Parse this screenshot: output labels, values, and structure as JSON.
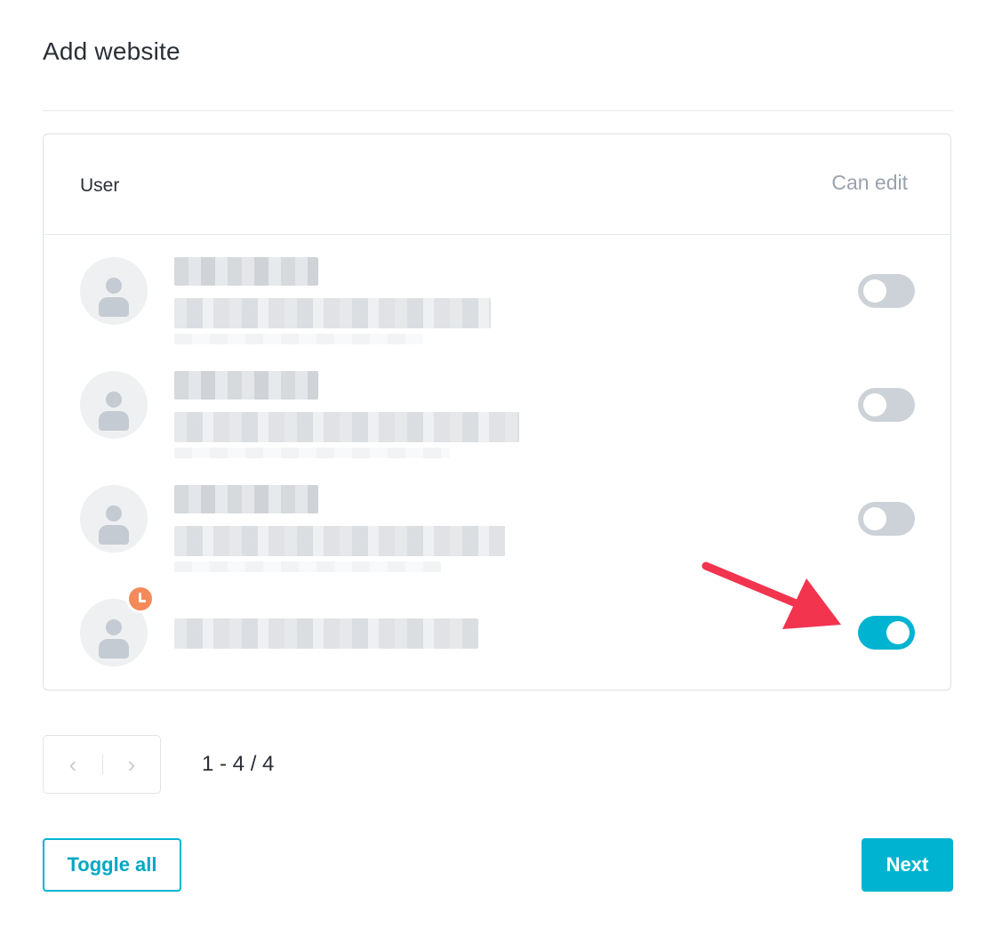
{
  "dialog": {
    "title": "Add website"
  },
  "table": {
    "columns": {
      "user": "User",
      "can_edit": "Can edit"
    },
    "rows": [
      {
        "name": "",
        "email": "",
        "can_edit": false,
        "pending": false
      },
      {
        "name": "",
        "email": "",
        "can_edit": false,
        "pending": false
      },
      {
        "name": "",
        "email": "",
        "can_edit": false,
        "pending": false
      },
      {
        "name": "",
        "email": "",
        "can_edit": true,
        "pending": true
      }
    ]
  },
  "pagination": {
    "prev_icon": "chevron-left-icon",
    "next_icon": "chevron-right-icon",
    "prev_glyph": "‹",
    "next_glyph": "›",
    "range": "1 - 4 / 4"
  },
  "actions": {
    "toggle_all": "Toggle all",
    "next": "Next"
  },
  "colors": {
    "accent": "#00b4d1",
    "toggle_off": "#ccd2d8",
    "pending_badge": "#f4895a",
    "annotation_arrow": "#f2344f"
  }
}
